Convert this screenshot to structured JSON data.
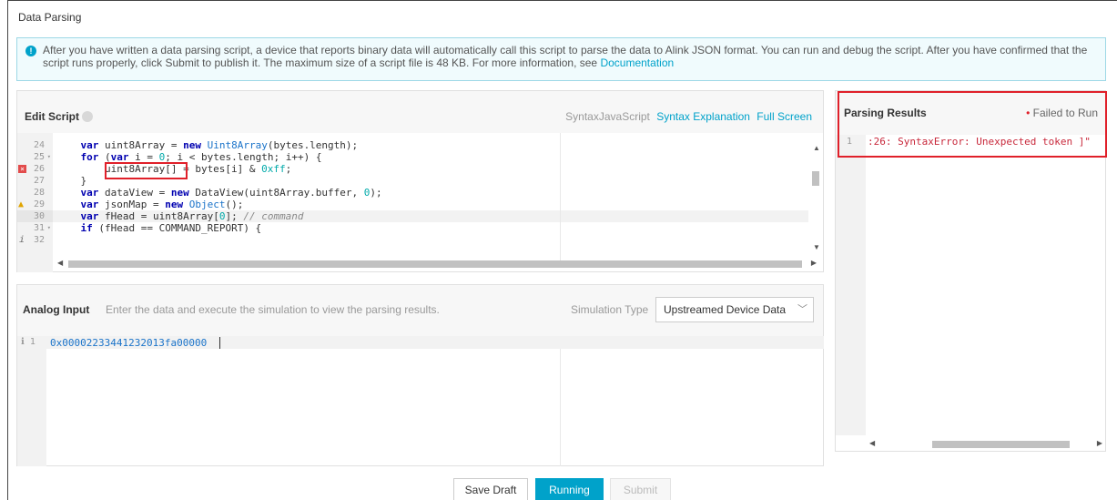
{
  "page": {
    "title": "Data Parsing"
  },
  "notice": {
    "text": "After you have written a data parsing script, a device that reports binary data will automatically call this script to parse the data to Alink JSON format. You can run and debug the script. After you have confirmed that the script runs properly, click Submit to publish it. The maximum size of a script file is 48 KB. For more information, see",
    "link": "Documentation"
  },
  "editor": {
    "label": "Edit Script",
    "syntax_prefix": "Syntax",
    "syntax_lang": "JavaScript",
    "syntax_explanation": "Syntax Explanation",
    "full_screen": "Full Screen",
    "line_numbers": [
      "24",
      "25",
      "26",
      "27",
      "28",
      "29",
      "30",
      "31",
      "32"
    ],
    "error_line": "26",
    "warning_line": "29",
    "active_line": "30"
  },
  "analog": {
    "label": "Analog Input",
    "hint": "Enter the data and execute the simulation to view the parsing results.",
    "simulation_type_label": "Simulation Type",
    "simulation_type_value": "Upstreamed Device Data",
    "line_number": "1",
    "input_value": "0x00002233441232013fa00000"
  },
  "results": {
    "label": "Parsing Results",
    "status": "Failed to Run",
    "line_number": "1",
    "output": ":26: SyntaxError: Unexpected token ]\""
  },
  "buttons": {
    "save_draft": "Save Draft",
    "running": "Running",
    "submit": "Submit"
  },
  "colors": {
    "accent": "#00a2ca",
    "error": "#e0202a",
    "error_text": "#c8283b"
  }
}
